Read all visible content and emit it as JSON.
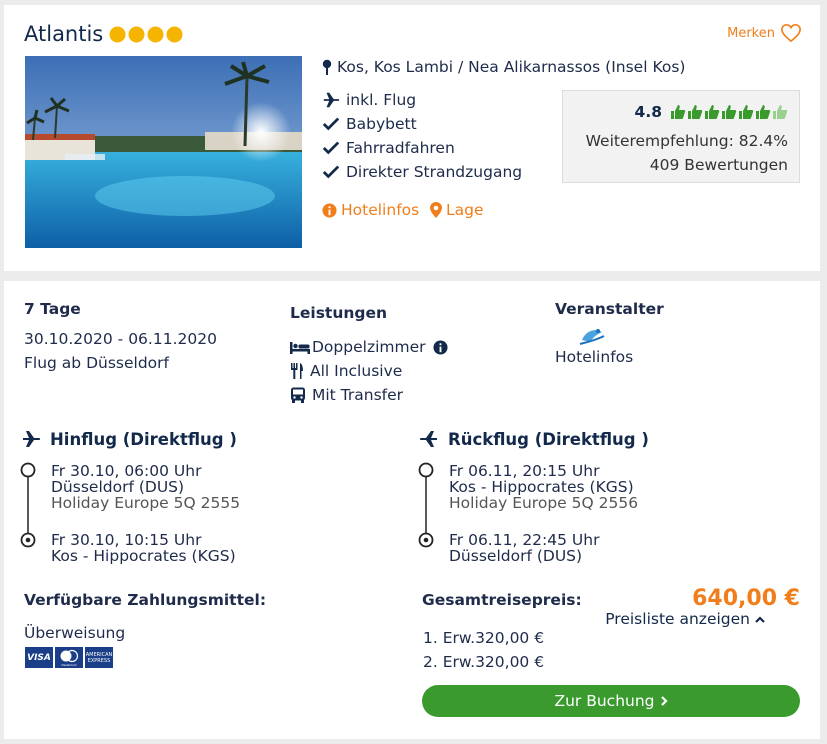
{
  "hotel": {
    "name": "Atlantis",
    "stars": 4,
    "merken_label": "Merken",
    "location": "Kos, Kos Lambi / Nea Alikarnassos (Insel Kos)",
    "features": [
      {
        "icon": "plane-icon",
        "label": "inkl. Flug"
      },
      {
        "icon": "check-icon",
        "label": "Babybett"
      },
      {
        "icon": "check-icon",
        "label": "Fahrradfahren"
      },
      {
        "icon": "check-icon",
        "label": "Direkter Strandzugang"
      }
    ],
    "links": {
      "hotelinfos": "Hotelinfos",
      "lage": "Lage"
    },
    "rating": {
      "score": "4.8",
      "thumbs": 6,
      "recommendation": "Weiterempfehlung: 82.4%",
      "reviews": "409 Bewertungen"
    }
  },
  "trip": {
    "duration": "7 Tage",
    "dates": "30.10.2020 - 06.11.2020",
    "departure": "Flug ab Düsseldorf"
  },
  "leistungen": {
    "title": "Leistungen",
    "items": [
      "Doppelzimmer",
      "All Inclusive",
      "Mit Transfer"
    ]
  },
  "veranstalter": {
    "title": "Veranstalter",
    "link": "Hotelinfos"
  },
  "hinflug": {
    "title": "Hinflug (Direktflug )",
    "dep_time": "Fr 30.10, 06:00 Uhr",
    "dep_airport": "Düsseldorf (DUS)",
    "airline": "Holiday Europe 5Q 2555",
    "arr_time": "Fr 30.10, 10:15 Uhr",
    "arr_airport": "Kos - Hippocrates (KGS)"
  },
  "rueckflug": {
    "title": "Rückflug (Direktflug )",
    "dep_time": "Fr 06.11, 20:15 Uhr",
    "dep_airport": "Kos - Hippocrates (KGS)",
    "airline": "Holiday Europe 5Q 2556",
    "arr_time": "Fr 06.11, 22:45 Uhr",
    "arr_airport": "Düsseldorf (DUS)"
  },
  "payment": {
    "title": "Verfügbare Zahlungsmittel:",
    "method": "Überweisung",
    "cards": [
      "VISA",
      "MasterCard",
      "AMERICAN EXPRESS"
    ]
  },
  "price": {
    "title": "Gesamtreisepreis:",
    "total": "640,00 €",
    "preisliste": "Preisliste anzeigen",
    "lines": [
      "1. Erw.320,00 €",
      "2. Erw.320,00 €"
    ],
    "booking_label": "Zur Buchung"
  },
  "colors": {
    "navy": "#13294b",
    "orange": "#f07e1b",
    "green": "#3a9a2e",
    "star": "#f5b400"
  }
}
